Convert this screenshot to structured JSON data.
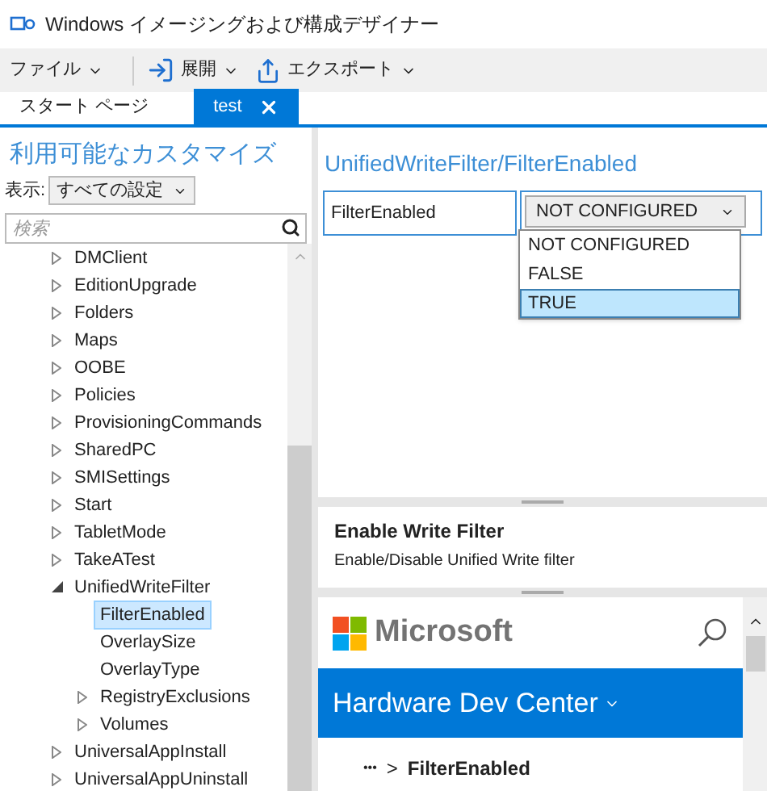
{
  "window": {
    "title": "Windows イメージングおよび構成デザイナー"
  },
  "menu": [
    {
      "label": "ファイル"
    },
    {
      "label": "展開"
    },
    {
      "label": "エクスポート"
    }
  ],
  "tabs": [
    {
      "label": "スタート ページ",
      "selected": false
    },
    {
      "label": "test",
      "selected": true
    }
  ],
  "sidebar": {
    "heading": "利用可能なカスタマイズ",
    "view_label": "表示:",
    "view_value": "すべての設定",
    "search": {
      "placeholder": "検索"
    },
    "tree": [
      {
        "label": "DMClient",
        "expanded": false,
        "selected": false
      },
      {
        "label": "EditionUpgrade",
        "expanded": false,
        "selected": false
      },
      {
        "label": "Folders",
        "expanded": false,
        "selected": false
      },
      {
        "label": "Maps",
        "expanded": false,
        "selected": false
      },
      {
        "label": "OOBE",
        "expanded": false,
        "selected": false
      },
      {
        "label": "Policies",
        "expanded": false,
        "selected": false
      },
      {
        "label": "ProvisioningCommands",
        "expanded": false,
        "selected": false
      },
      {
        "label": "SharedPC",
        "expanded": false,
        "selected": false
      },
      {
        "label": "SMISettings",
        "expanded": false,
        "selected": false
      },
      {
        "label": "Start",
        "expanded": false,
        "selected": false
      },
      {
        "label": "TabletMode",
        "expanded": false,
        "selected": false
      },
      {
        "label": "TakeATest",
        "expanded": false,
        "selected": false
      },
      {
        "label": "UnifiedWriteFilter",
        "expanded": true,
        "selected": false,
        "children": [
          {
            "label": "FilterEnabled",
            "selected": true
          },
          {
            "label": "OverlaySize",
            "selected": false
          },
          {
            "label": "OverlayType",
            "selected": false
          },
          {
            "label": "RegistryExclusions",
            "expanded": false,
            "selected": false
          },
          {
            "label": "Volumes",
            "expanded": false,
            "selected": false
          }
        ]
      },
      {
        "label": "UniversalAppInstall",
        "expanded": false,
        "selected": false
      },
      {
        "label": "UniversalAppUninstall",
        "expanded": false,
        "selected": false
      }
    ]
  },
  "setting": {
    "heading": "UnifiedWriteFilter/FilterEnabled",
    "name": "FilterEnabled",
    "value": "NOT CONFIGURED",
    "options": [
      {
        "label": "NOT CONFIGURED",
        "highlighted": false
      },
      {
        "label": "FALSE",
        "highlighted": false
      },
      {
        "label": "TRUE",
        "highlighted": true
      }
    ]
  },
  "description": {
    "title": "Enable Write Filter",
    "text": "Enable/Disable Unified Write filter"
  },
  "web": {
    "brand": "Microsoft",
    "banner": "Hardware Dev Center",
    "breadcrumb_more": "•••",
    "breadcrumb_sep": ">",
    "breadcrumb": "FilterEnabled"
  }
}
